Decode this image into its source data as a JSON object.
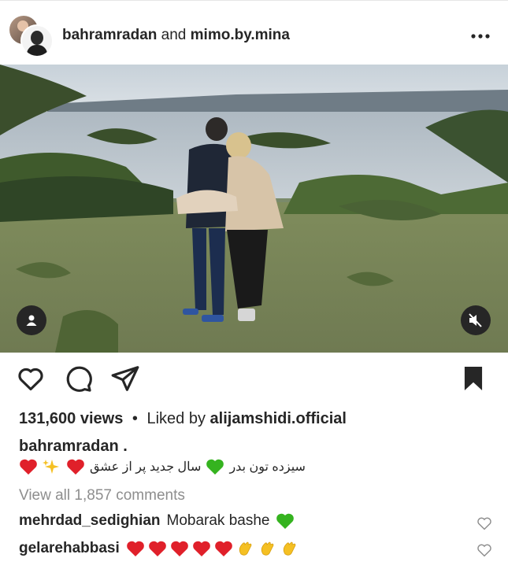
{
  "header": {
    "user1": "bahramradan",
    "conjunction": "and",
    "user2": "mimo.by.mina",
    "more_icon": "more-dots-icon"
  },
  "media": {
    "user_tag_icon": "person-icon",
    "mute_icon": "muted-speaker-icon"
  },
  "actions": {
    "like_icon": "heart-outline-icon",
    "comment_icon": "comment-bubble-icon",
    "share_icon": "paper-plane-icon",
    "save_icon": "bookmark-filled-icon"
  },
  "stats": {
    "views": "131,600 views",
    "separator": "•",
    "liked_by_prefix": "Liked by",
    "liked_by_user": "alijamshidi.official"
  },
  "caption": {
    "owner": "bahramradan .",
    "text_part1": "سیزده تون بدر",
    "text_part2": "سال جدید پر از عشق"
  },
  "comments": {
    "view_all": "View all 1,857 comments",
    "items": [
      {
        "user": "mehrdad_sedighian",
        "text": "Mobarak bashe"
      },
      {
        "user": "gelarehabbasi",
        "text": ""
      }
    ]
  },
  "colors": {
    "text": "#262626",
    "muted": "#8e8e8e",
    "heart_red": "#e0202a",
    "heart_green": "#35b31f",
    "clap_yellow": "#f5c023"
  }
}
